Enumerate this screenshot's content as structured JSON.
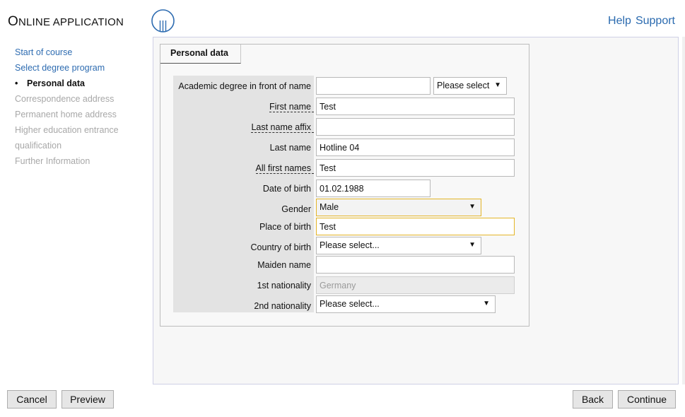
{
  "header": {
    "title_cap": "O",
    "title_rest": "NLINE APPLICATION",
    "links": [
      "Help",
      "Support"
    ]
  },
  "nav": {
    "items": [
      {
        "label": "Start of course",
        "state": "link"
      },
      {
        "label": "Select degree program",
        "state": "link"
      },
      {
        "label": "Personal data",
        "state": "current"
      },
      {
        "label": "Correspondence address",
        "state": "disabled"
      },
      {
        "label": "Permanent home address",
        "state": "disabled"
      },
      {
        "label": "Higher education entrance",
        "state": "disabled"
      },
      {
        "label": "qualification",
        "state": "disabled"
      },
      {
        "label": "Further Information",
        "state": "disabled"
      }
    ]
  },
  "form": {
    "tab_label": "Personal data",
    "academic_degree": {
      "label": "Academic degree in front of name",
      "value": "",
      "select": "Please select"
    },
    "first_name": {
      "label": "First name",
      "value": "Test"
    },
    "last_name_affix": {
      "label": "Last name affix",
      "value": ""
    },
    "last_name": {
      "label": "Last name",
      "value": "Hotline 04"
    },
    "all_first_names": {
      "label": "All first names",
      "value": "Test"
    },
    "date_of_birth": {
      "label": "Date of birth",
      "value": "01.02.1988"
    },
    "gender": {
      "label": "Gender",
      "value": "Male"
    },
    "place_of_birth": {
      "label": "Place of birth",
      "value": "Test"
    },
    "country_of_birth": {
      "label": "Country of birth",
      "value": "Please select..."
    },
    "maiden_name": {
      "label": "Maiden name",
      "value": ""
    },
    "nationality_1": {
      "label": "1st nationality",
      "value": "Germany"
    },
    "nationality_2": {
      "label": "2nd nationality",
      "value": "Please select..."
    }
  },
  "footer": {
    "cancel": "Cancel",
    "preview": "Preview",
    "back": "Back",
    "continue": "Continue"
  },
  "colors": {
    "link": "#2e6cb1",
    "focus_border": "#e4b528",
    "label_bg": "#e3e3e3"
  }
}
